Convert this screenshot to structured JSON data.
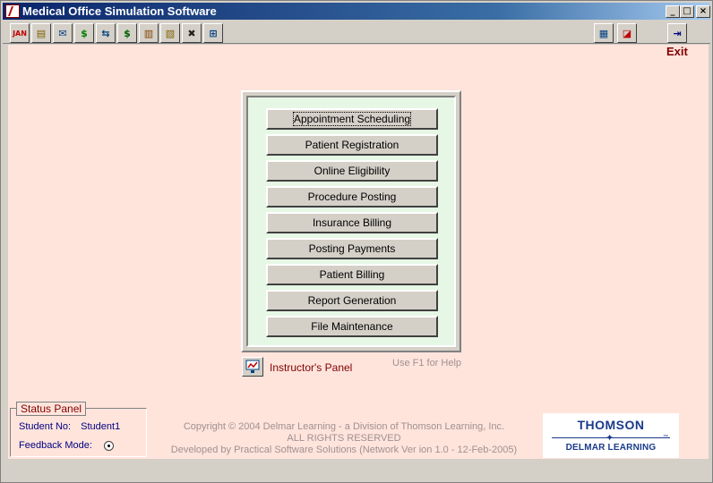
{
  "window": {
    "title": "Medical Office Simulation Software",
    "min": "_",
    "max": "□",
    "close": "×"
  },
  "toolbar": {
    "items": [
      {
        "name": "calendar-icon",
        "glyph": "JAN",
        "color": "#c00000"
      },
      {
        "name": "patient-folder-icon",
        "glyph": "▤",
        "color": "#806000"
      },
      {
        "name": "eligibility-icon",
        "glyph": "✉",
        "color": "#004080"
      },
      {
        "name": "dollar-icon",
        "glyph": "$",
        "color": "#008000"
      },
      {
        "name": "transfer-icon",
        "glyph": "⇆",
        "color": "#004080"
      },
      {
        "name": "payments-icon",
        "glyph": "$",
        "color": "#006000"
      },
      {
        "name": "billing-icon",
        "glyph": "▥",
        "color": "#804000"
      },
      {
        "name": "reports-icon",
        "glyph": "▧",
        "color": "#806000"
      },
      {
        "name": "tools-icon",
        "glyph": "✖",
        "color": "#202020"
      },
      {
        "name": "instructor-icon",
        "glyph": "⊞",
        "color": "#004080"
      }
    ],
    "right_items": [
      {
        "name": "calculator-icon",
        "glyph": "▦",
        "color": "#004080"
      },
      {
        "name": "windows-icon",
        "glyph": "◪",
        "color": "#c00000"
      }
    ],
    "exit": {
      "name": "exit-door-icon",
      "glyph": "⇥",
      "color": "#000080"
    }
  },
  "exit_label": "Exit",
  "menu": [
    "Appointment Scheduling",
    "Patient Registration",
    "Online Eligibility",
    "Procedure Posting",
    "Insurance Billing",
    "Posting Payments",
    "Patient Billing",
    "Report Generation",
    "File Maintenance"
  ],
  "instructor_label": "Instructor's Panel",
  "help_hint": "Use F1 for Help",
  "status": {
    "title": "Status Panel",
    "student_label": "Student No:",
    "student_value": "Student1",
    "feedback_label": "Feedback Mode:"
  },
  "copyright": [
    "Copyright © 2004 Delmar Learning - a Division of Thomson Learning, Inc.",
    "ALL RIGHTS RESERVED",
    "Developed by Practical Software Solutions (Network Ver ion 1.0 - 12-Feb-2005)"
  ],
  "logo": {
    "top": "THOMSON",
    "bottom": "DELMAR LEARNING",
    "star": "✦",
    "tm": "™"
  }
}
